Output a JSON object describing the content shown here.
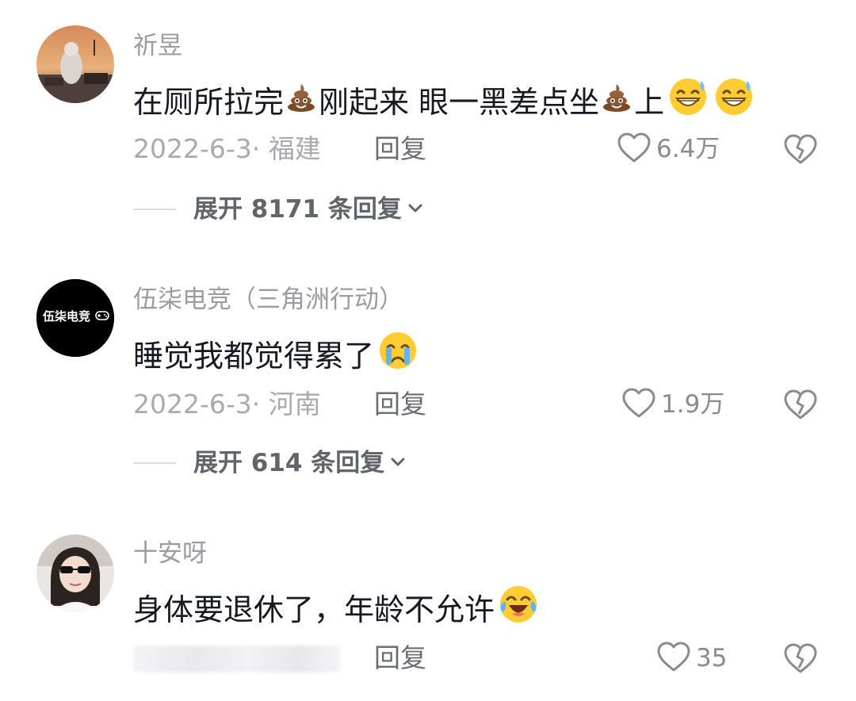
{
  "comments": [
    {
      "username": "祈昱",
      "content": {
        "p1": "在厕所拉完",
        "e1": "poop-emoji",
        "p2": " 刚起来 眼一黑差点坐",
        "e2": "poop-emoji",
        "p3": "上",
        "e3": "grinning-sweat-emoji",
        "e4": "grinning-sweat-emoji"
      },
      "meta": "2022-6-3· 福建",
      "reply_label": "回复",
      "like_count": "6.4万",
      "expand_label": "展开 8171 条回复"
    },
    {
      "username": "伍柒电竞（三角洲行动）",
      "avatar_text": "伍柒电竞",
      "content": {
        "p1": "睡觉我都觉得累了",
        "e1": "crying-face-emoji"
      },
      "meta": "2022-6-3· 河南",
      "reply_label": "回复",
      "like_count": "1.9万",
      "expand_label": "展开 614 条回复"
    },
    {
      "username": "十安呀",
      "content": {
        "p1": "身体要退休了，年龄不允许",
        "e1": "laughing-tears-emoji"
      },
      "meta": "",
      "reply_label": "回复",
      "like_count": "35"
    }
  ],
  "colors": {
    "username": "#9b9ca1",
    "content": "#161823",
    "meta": "#a9aab0",
    "reply": "#6b6d75",
    "expand": "#62646c",
    "emoji_yellow": "#ffcc33",
    "poop_brown": "#7a4a24"
  },
  "icons": {
    "like": "heart-outline-icon",
    "dislike": "broken-heart-icon",
    "expand": "chevron-down-icon"
  }
}
